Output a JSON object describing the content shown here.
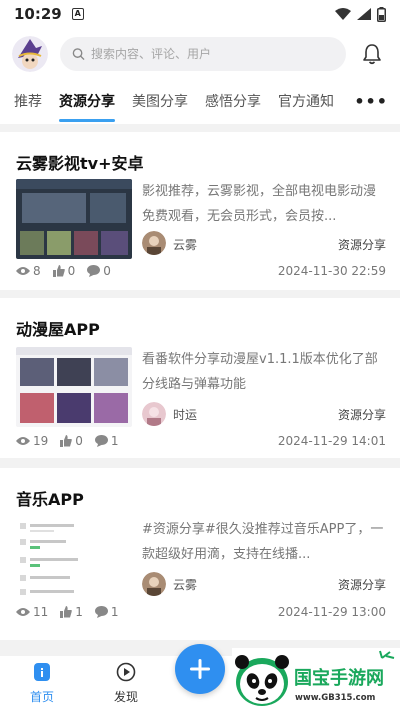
{
  "status_bar": {
    "time": "10:29",
    "a_icon": "A"
  },
  "header": {
    "search_placeholder": "搜索内容、评论、用户"
  },
  "tabs": [
    {
      "label": "推荐",
      "active": false
    },
    {
      "label": "资源分享",
      "active": true
    },
    {
      "label": "美图分享",
      "active": false
    },
    {
      "label": "感悟分享",
      "active": false
    },
    {
      "label": "官方通知",
      "active": false
    }
  ],
  "tabs_more": "•••",
  "posts": [
    {
      "title": "云雾影视tv+安卓",
      "excerpt": "影视推荐，云雾影视，全部电视电影动漫免费观看，无会员形式，会员按...",
      "author": "云雾",
      "category": "资源分享",
      "views": "8",
      "likes": "0",
      "comments": "0",
      "date": "2024-11-30 22:59"
    },
    {
      "title": "动漫屋APP",
      "excerpt": "看番软件分享动漫屋v1.1.1版本优化了部分线路与弹幕功能",
      "author": "时运",
      "category": "资源分享",
      "views": "19",
      "likes": "0",
      "comments": "1",
      "date": "2024-11-29 14:01"
    },
    {
      "title": "音乐APP",
      "excerpt": "#资源分享#很久没推荐过音乐APP了，一款超级好用滴，支持在线播...",
      "author": "云雾",
      "category": "资源分享",
      "views": "11",
      "likes": "1",
      "comments": "1",
      "date": "2024-11-29 13:00"
    }
  ],
  "bottom_nav": [
    {
      "label": "首页",
      "active": true
    },
    {
      "label": "发现",
      "active": false
    }
  ],
  "watermark": {
    "brand": "国宝手游网",
    "url": "www.GB315.com"
  },
  "colors": {
    "accent": "#3aa0f0",
    "fab": "#2f8ff0",
    "brand_green": "#1aa85c"
  }
}
